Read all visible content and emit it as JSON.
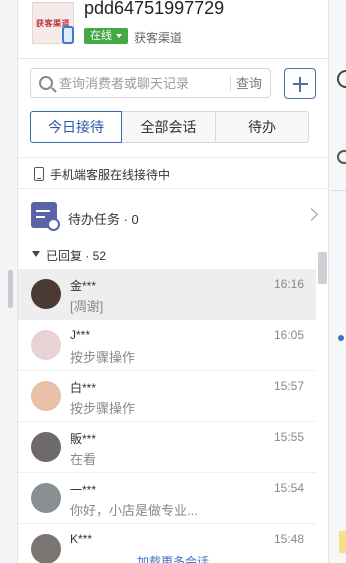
{
  "header": {
    "logo_text": "获客渠道",
    "shop_name": "pdd64751997729",
    "status": "在线",
    "channel": "获客渠道"
  },
  "search": {
    "placeholder": "查询消费者或聊天记录",
    "button_label": "查询"
  },
  "tabs": [
    {
      "label": "今日接待",
      "active": true
    },
    {
      "label": "全部会话",
      "active": false
    },
    {
      "label": "待办",
      "active": false
    }
  ],
  "mobile_notice": "手机端客服在线接待中",
  "todo": {
    "label": "待办任务 · 0"
  },
  "group": {
    "label": "已回复 · 52"
  },
  "conversations": [
    {
      "name": "金***",
      "time": "16:16",
      "message": "[凋谢]",
      "avatar_color": "#4a3a33",
      "active": true
    },
    {
      "name": "J***",
      "time": "16:05",
      "message": "按步骤操作",
      "avatar_color": "#e8d2d6",
      "active": false
    },
    {
      "name": "白***",
      "time": "15:57",
      "message": "按步骤操作",
      "avatar_color": "#e9bfa7",
      "active": false
    },
    {
      "name": "販***",
      "time": "15:55",
      "message": "在看",
      "avatar_color": "#6f6a6a",
      "active": false
    },
    {
      "name": "一***",
      "time": "15:54",
      "message": "你好，小店是做专业...",
      "avatar_color": "#8a9092",
      "active": false
    },
    {
      "name": "K***",
      "time": "15:48",
      "message": "",
      "avatar_color": "#7a7472",
      "active": false
    }
  ],
  "load_more": "加载更多会话",
  "colors": {
    "accent": "#2c58a8",
    "status_green": "#44a844",
    "todo_purple": "#5a63a8",
    "link_blue": "#3b72c8"
  }
}
